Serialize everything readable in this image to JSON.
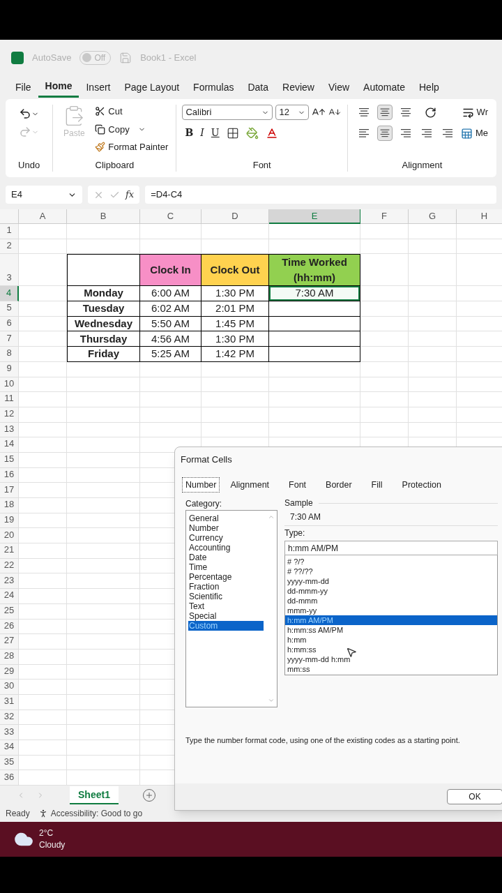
{
  "title_bar": {
    "autosave": "AutoSave",
    "toggle": {
      "label": "Off",
      "on": false
    },
    "title": "Book1  -  Excel"
  },
  "tabs": [
    {
      "label": "File",
      "selected": false
    },
    {
      "label": "Home",
      "selected": true
    },
    {
      "label": "Insert",
      "selected": false
    },
    {
      "label": "Page Layout",
      "selected": false
    },
    {
      "label": "Formulas",
      "selected": false
    },
    {
      "label": "Data",
      "selected": false
    },
    {
      "label": "Review",
      "selected": false
    },
    {
      "label": "View",
      "selected": false
    },
    {
      "label": "Automate",
      "selected": false
    },
    {
      "label": "Help",
      "selected": false
    }
  ],
  "ribbon": {
    "undo": {
      "label": "Undo",
      "redo_disabled": true
    },
    "clipboard": {
      "label": "Clipboard",
      "paste": {
        "label": "Paste",
        "disabled": true
      },
      "cut": "Cut",
      "copy": "Copy",
      "format_painter": "Format Painter"
    },
    "font": {
      "label": "Font",
      "family": "Calibri",
      "size": "12",
      "styles": [
        "B",
        "I",
        "U"
      ]
    },
    "alignment": {
      "label": "Alignment",
      "wrap": "Wr",
      "merge": "Me"
    }
  },
  "formula_bar": {
    "name_box": "E4",
    "fx": "fx",
    "formula": "=D4-C4"
  },
  "sheet": {
    "columns": [
      {
        "label": "A",
        "selected": false
      },
      {
        "label": "B",
        "selected": false
      },
      {
        "label": "C",
        "selected": false
      },
      {
        "label": "D",
        "selected": false
      },
      {
        "label": "E",
        "selected": true
      },
      {
        "label": "F",
        "selected": false
      },
      {
        "label": "G",
        "selected": false
      },
      {
        "label": "H",
        "selected": false
      }
    ],
    "rows": [
      {
        "label": "1",
        "selected": false
      },
      {
        "label": "2",
        "selected": false
      },
      {
        "label": "3",
        "selected": false
      },
      {
        "label": "4",
        "selected": true
      },
      {
        "label": "5",
        "selected": false
      },
      {
        "label": "6",
        "selected": false
      },
      {
        "label": "7",
        "selected": false
      },
      {
        "label": "8",
        "selected": false
      },
      {
        "label": "9",
        "selected": false
      },
      {
        "label": "10",
        "selected": false
      },
      {
        "label": "11",
        "selected": false
      },
      {
        "label": "12",
        "selected": false
      },
      {
        "label": "13",
        "selected": false
      },
      {
        "label": "14",
        "selected": false
      },
      {
        "label": "15",
        "selected": false
      },
      {
        "label": "16",
        "selected": false
      },
      {
        "label": "17",
        "selected": false
      },
      {
        "label": "18",
        "selected": false
      },
      {
        "label": "19",
        "selected": false
      },
      {
        "label": "20",
        "selected": false
      },
      {
        "label": "21",
        "selected": false
      },
      {
        "label": "22",
        "selected": false
      },
      {
        "label": "23",
        "selected": false
      },
      {
        "label": "24",
        "selected": false
      },
      {
        "label": "25",
        "selected": false
      },
      {
        "label": "26",
        "selected": false
      },
      {
        "label": "27",
        "selected": false
      },
      {
        "label": "28",
        "selected": false
      },
      {
        "label": "29",
        "selected": false
      },
      {
        "label": "30",
        "selected": false
      },
      {
        "label": "31",
        "selected": false
      },
      {
        "label": "32",
        "selected": false
      },
      {
        "label": "33",
        "selected": false
      },
      {
        "label": "34",
        "selected": false
      },
      {
        "label": "35",
        "selected": false
      },
      {
        "label": "36",
        "selected": false
      }
    ]
  },
  "table": {
    "header": [
      {
        "text": "Clock In",
        "color": "#f78fc6"
      },
      {
        "text": "Clock Out",
        "color": "#ffd24f"
      },
      {
        "text": "Time Worked (hh:mm)",
        "color": "#92d050"
      }
    ],
    "rows": [
      {
        "cells": [
          {
            "text": "Monday",
            "selected": false
          },
          {
            "text": "6:00 AM",
            "selected": false
          },
          {
            "text": "1:30 PM",
            "selected": false
          },
          {
            "text": "7:30 AM",
            "selected": true
          }
        ]
      },
      {
        "cells": [
          {
            "text": "Tuesday",
            "selected": false
          },
          {
            "text": "6:02 AM",
            "selected": false
          },
          {
            "text": "2:01 PM",
            "selected": false
          }
        ]
      },
      {
        "cells": [
          {
            "text": "Wednesday",
            "selected": false
          },
          {
            "text": "5:50 AM",
            "selected": false
          },
          {
            "text": "1:45 PM",
            "selected": false
          }
        ]
      },
      {
        "cells": [
          {
            "text": "Thursday",
            "selected": false
          },
          {
            "text": "4:56 AM",
            "selected": false
          },
          {
            "text": "1:30 PM",
            "selected": false
          }
        ]
      },
      {
        "cells": [
          {
            "text": "Friday",
            "selected": false
          },
          {
            "text": "5:25 AM",
            "selected": false
          },
          {
            "text": "1:42 PM",
            "selected": false
          }
        ]
      }
    ]
  },
  "dialog": {
    "title": "Format Cells",
    "tabs": [
      {
        "label": "Number",
        "selected": true
      },
      {
        "label": "Alignment",
        "selected": false
      },
      {
        "label": "Font",
        "selected": false
      },
      {
        "label": "Border",
        "selected": false
      },
      {
        "label": "Fill",
        "selected": false
      },
      {
        "label": "Protection",
        "selected": false
      }
    ],
    "category_label": "Category:",
    "categories": [
      {
        "label": "General",
        "selected": false
      },
      {
        "label": "Number",
        "selected": false
      },
      {
        "label": "Currency",
        "selected": false
      },
      {
        "label": "Accounting",
        "selected": false
      },
      {
        "label": "Date",
        "selected": false
      },
      {
        "label": "Time",
        "selected": false
      },
      {
        "label": "Percentage",
        "selected": false
      },
      {
        "label": "Fraction",
        "selected": false
      },
      {
        "label": "Scientific",
        "selected": false
      },
      {
        "label": "Text",
        "selected": false
      },
      {
        "label": "Special",
        "selected": false
      },
      {
        "label": "Custom",
        "selected": true
      }
    ],
    "sample_label": "Sample",
    "sample": "7:30 AM",
    "type_label": "Type:",
    "type_value": "h:mm AM/PM",
    "types": [
      {
        "label": "# ?/?",
        "selected": false
      },
      {
        "label": "# ??/??",
        "selected": false
      },
      {
        "label": "yyyy-mm-dd",
        "selected": false
      },
      {
        "label": "dd-mmm-yy",
        "selected": false
      },
      {
        "label": "dd-mmm",
        "selected": false
      },
      {
        "label": "mmm-yy",
        "selected": false
      },
      {
        "label": "h:mm AM/PM",
        "selected": true
      },
      {
        "label": "h:mm:ss AM/PM",
        "selected": false
      },
      {
        "label": "h:mm",
        "selected": false
      },
      {
        "label": "h:mm:ss",
        "selected": false
      },
      {
        "label": "yyyy-mm-dd h:mm",
        "selected": false
      },
      {
        "label": "mm:ss",
        "selected": false
      }
    ],
    "hint": "Type the number format code, using one of the existing codes as a starting point.",
    "ok": "OK"
  },
  "sheet_tabs": [
    {
      "label": "Sheet1",
      "selected": true
    }
  ],
  "status_bar": {
    "ready": "Ready",
    "accessibility": "Accessibility: Good to go"
  },
  "taskbar": {
    "temperature": "2°C",
    "weather": "Cloudy"
  }
}
